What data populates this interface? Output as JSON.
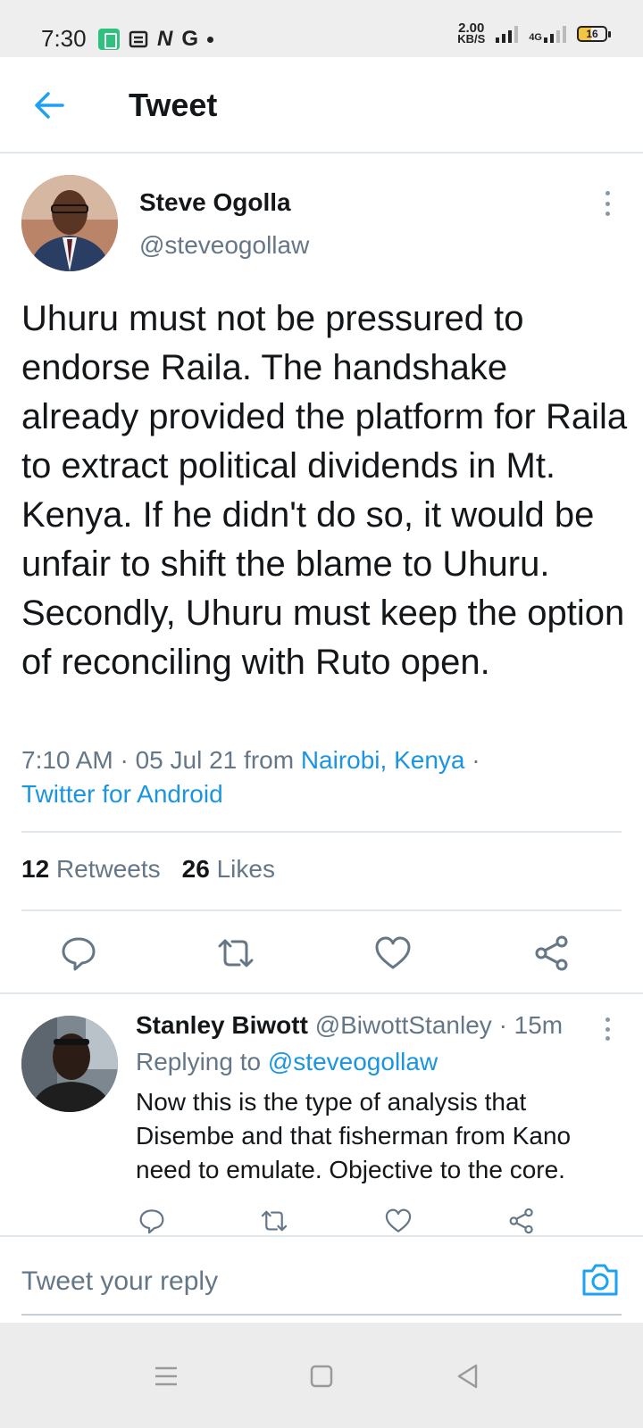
{
  "status_bar": {
    "time": "7:30",
    "glyph_n": "N",
    "glyph_g": "G",
    "speed_value": "2.00",
    "speed_unit": "KB/S",
    "network": "4G",
    "battery": "16"
  },
  "header": {
    "title": "Tweet",
    "back_icon": "back-arrow-icon"
  },
  "tweet": {
    "author_name": "Steve Ogolla",
    "author_handle": "@steveogollaw",
    "text": "Uhuru must not be pressured to endorse Raila. The handshake already provided the platform for Raila to extract political dividends in Mt. Kenya. If he didn't do so, it would be unfair to shift the blame to Uhuru. Secondly, Uhuru must keep the option of reconciling with Ruto open.",
    "timestamp": "7:10 AM · 05 Jul 21 from ",
    "location": "Nairobi, Kenya",
    "separator": " ·",
    "client": "Twitter for Android",
    "retweets_count": "12",
    "retweets_label": "Retweets",
    "likes_count": "26",
    "likes_label": "Likes"
  },
  "reply": {
    "author_name": "Stanley Biwott",
    "author_handle": "@BiwottStanley",
    "time_ago": "· 15m",
    "replying_prefix": "Replying to ",
    "replying_handle": "@steveogollaw",
    "text": "Now this is the type of analysis that Disembe and that fisherman from Kano need to emulate. Objective to the core."
  },
  "compose": {
    "placeholder": "Tweet your reply"
  },
  "colors": {
    "accent": "#1da1f2",
    "link": "#1b95e0",
    "muted": "#657786",
    "text": "#14171a",
    "border": "#e1e8ed"
  }
}
